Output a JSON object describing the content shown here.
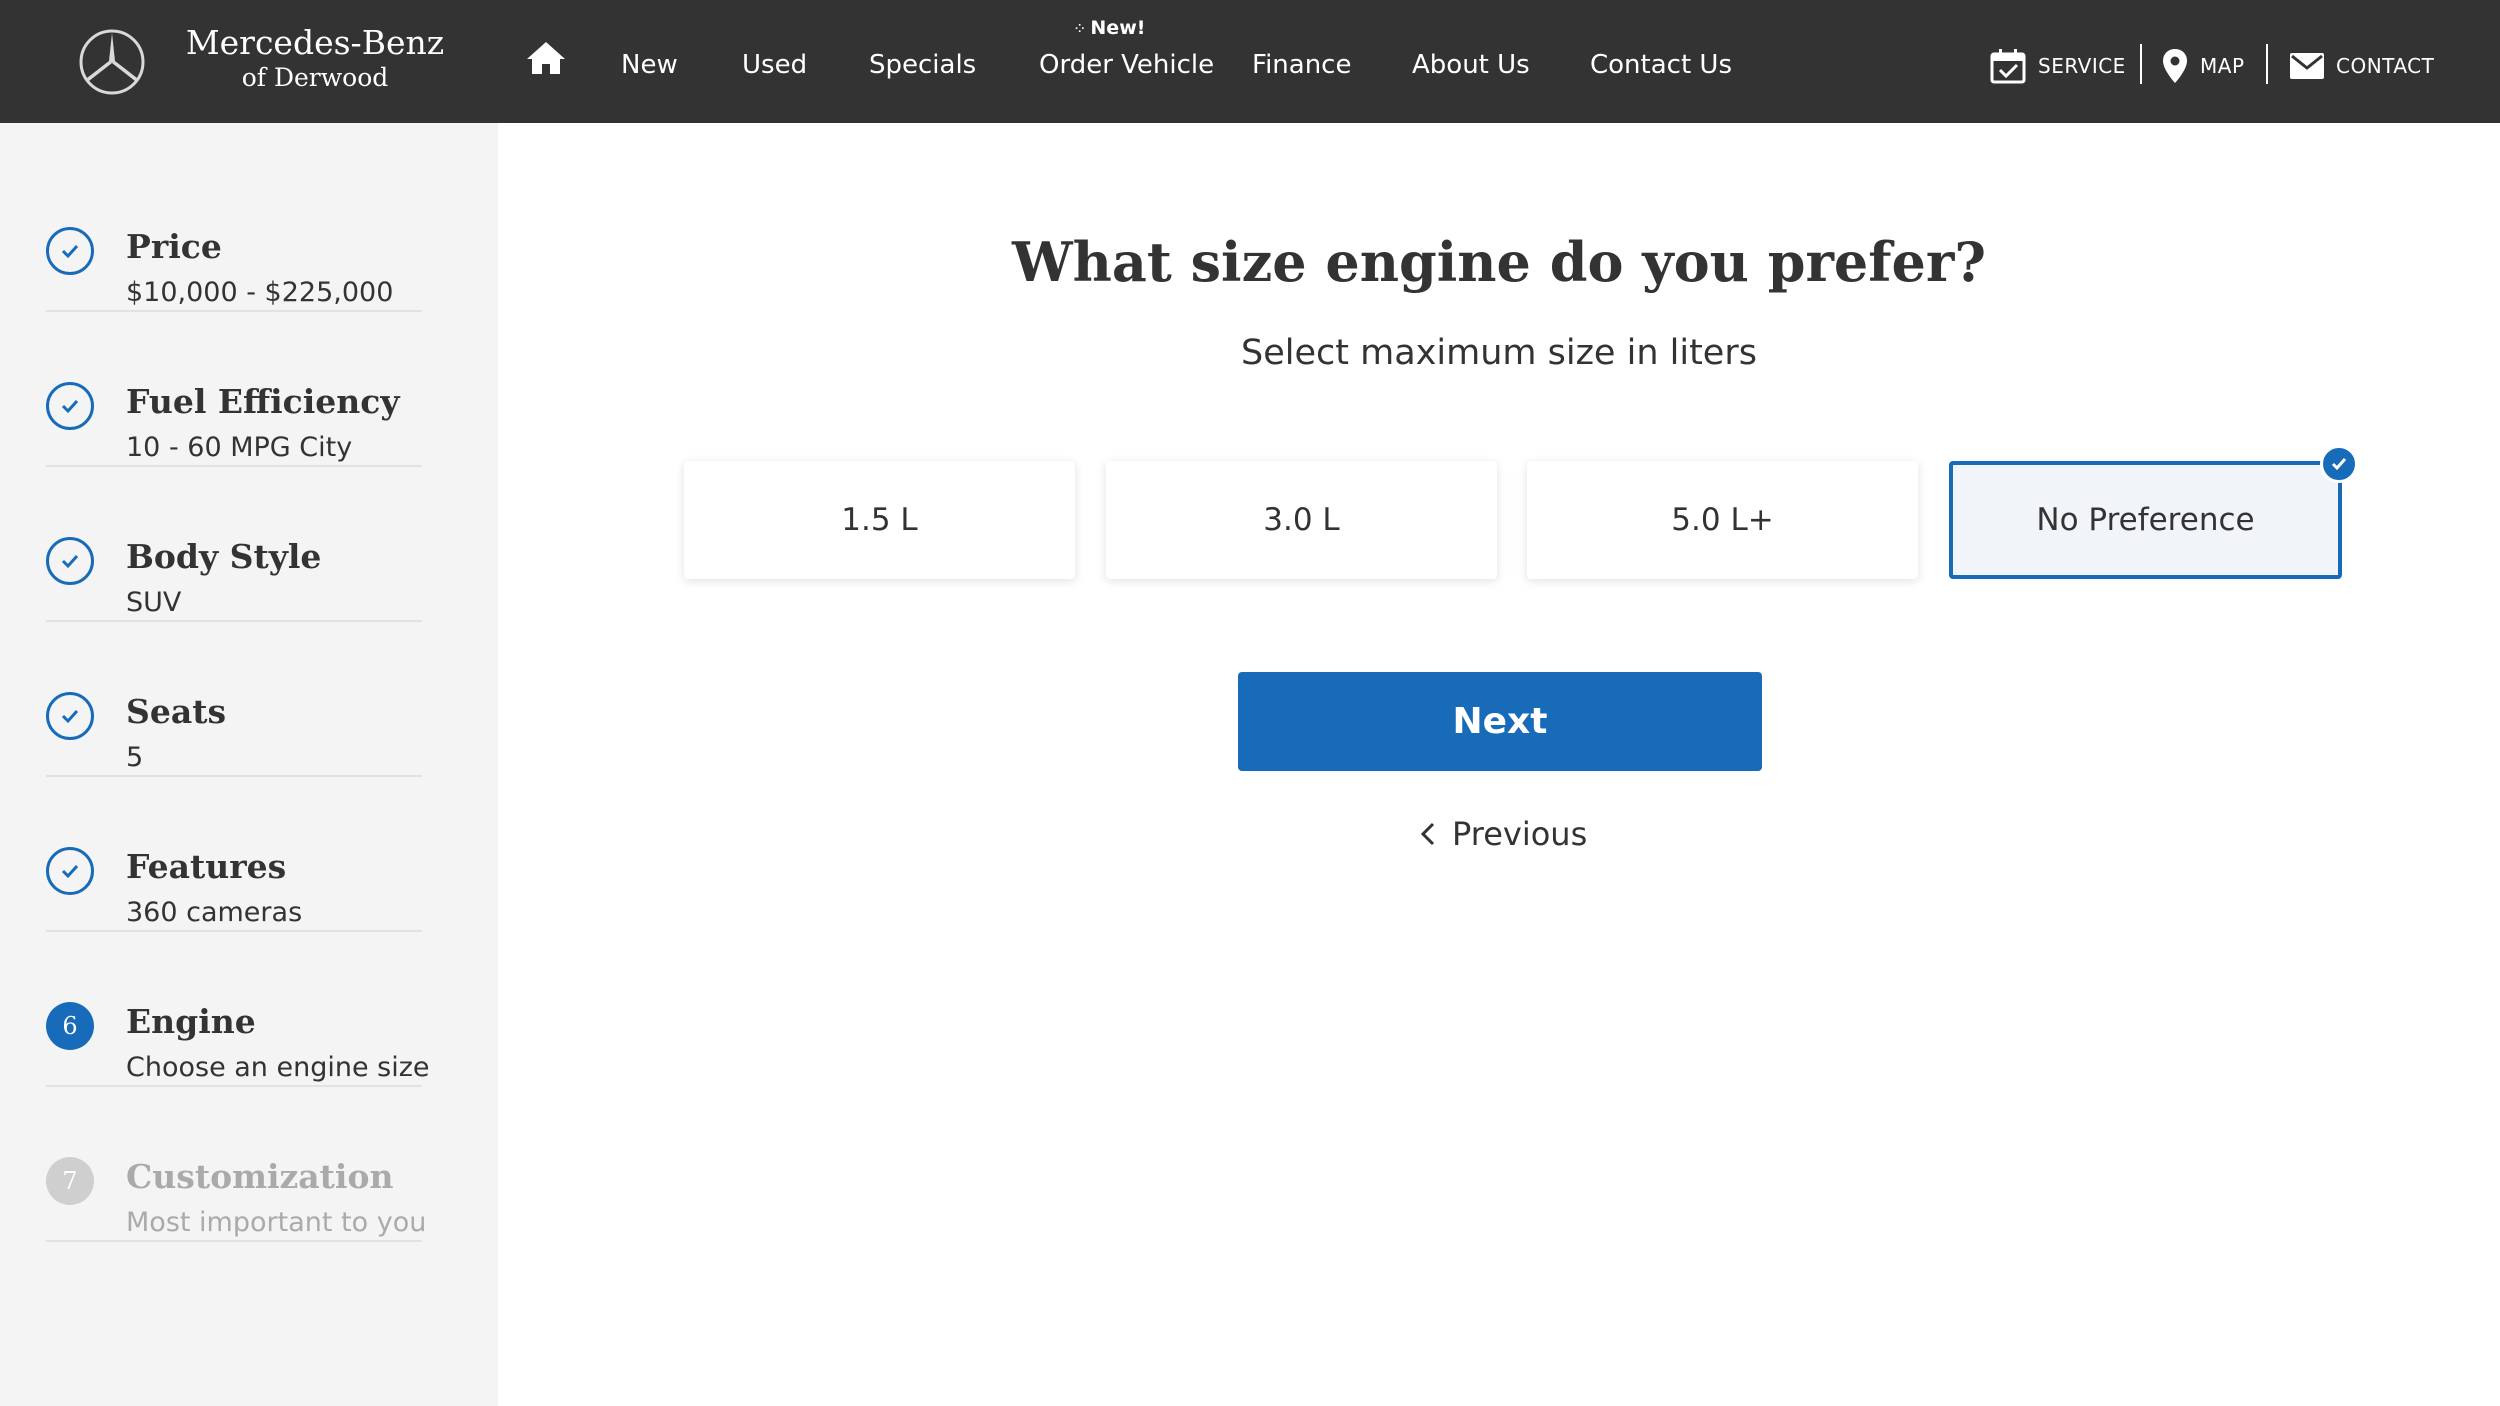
{
  "header": {
    "brand_line1": "Mercedes-Benz",
    "brand_line2": "of Derwood",
    "nav": [
      {
        "label": "New"
      },
      {
        "label": "Used"
      },
      {
        "label": "Specials"
      },
      {
        "label": "Order Vehicle",
        "badge": "New!"
      },
      {
        "label": "Finance"
      },
      {
        "label": "About Us"
      },
      {
        "label": "Contact Us"
      }
    ],
    "utility": {
      "service": "SERVICE",
      "map": "MAP",
      "contact": "CONTACT"
    },
    "icons": [
      "mercedes-star-icon",
      "home-icon",
      "calendar-icon",
      "map-pin-icon",
      "envelope-icon"
    ]
  },
  "sidebar": {
    "steps": [
      {
        "title": "Price",
        "sub": "$10,000 - $225,000",
        "state": "done"
      },
      {
        "title": "Fuel Efficiency",
        "sub": "10 - 60 MPG City",
        "state": "done"
      },
      {
        "title": "Body Style",
        "sub": "SUV",
        "state": "done"
      },
      {
        "title": "Seats",
        "sub": "5",
        "state": "done"
      },
      {
        "title": "Features",
        "sub": "360 cameras",
        "state": "done"
      },
      {
        "title": "Engine",
        "sub": "Choose an engine size",
        "state": "active",
        "number": "6"
      },
      {
        "title": "Customization",
        "sub": "Most important to you",
        "state": "pending",
        "number": "7"
      }
    ]
  },
  "main": {
    "question": "What size engine do you prefer?",
    "subquestion": "Select maximum size in liters",
    "options": [
      {
        "label": "1.5 L",
        "selected": false
      },
      {
        "label": "3.0 L",
        "selected": false
      },
      {
        "label": "5.0 L+",
        "selected": false
      },
      {
        "label": "No Preference",
        "selected": true
      }
    ],
    "next_label": "Next",
    "previous_label": "Previous"
  },
  "colors": {
    "header_bg": "#333333",
    "accent": "#176bb9",
    "sidebar_bg": "#f4f4f4",
    "selected_bg": "#f1f5fa",
    "pending": "#cfcfcf"
  }
}
